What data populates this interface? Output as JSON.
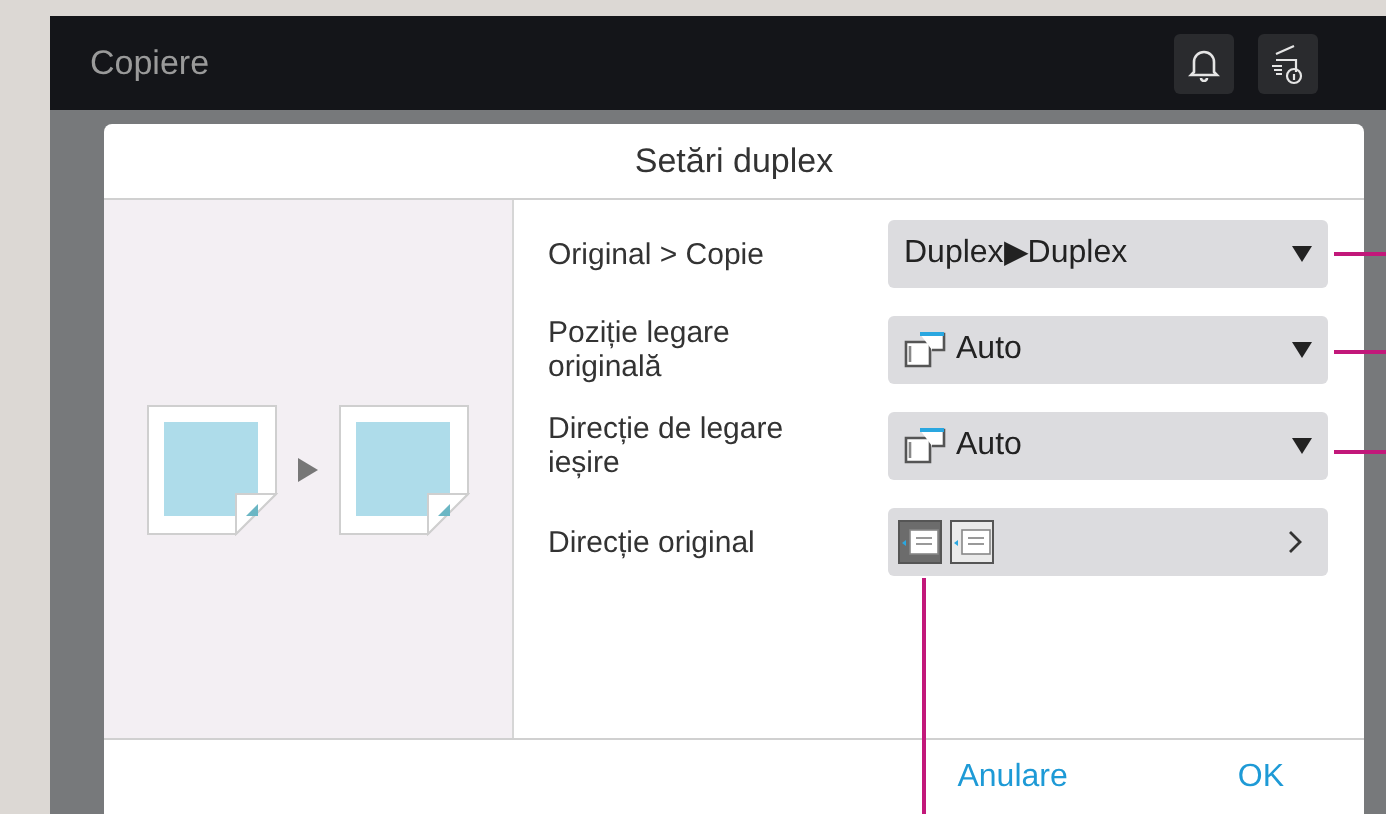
{
  "header": {
    "title": "Copiere"
  },
  "dialog": {
    "title": "Setări duplex",
    "rows": [
      {
        "kind": "dropdown",
        "label": "Original > Copie",
        "value_parts": [
          "Duplex",
          "▶",
          "Duplex"
        ]
      },
      {
        "kind": "dropdown",
        "label": "Poziție legare originală",
        "icon": true,
        "value_parts": [
          "Auto"
        ]
      },
      {
        "kind": "dropdown",
        "label": "Direcție de legare ieșire",
        "icon": true,
        "value_parts": [
          "Auto"
        ]
      },
      {
        "kind": "nav",
        "label": "Direcție original",
        "value_parts": []
      }
    ],
    "buttons": [
      "Anulare",
      "OK"
    ]
  }
}
